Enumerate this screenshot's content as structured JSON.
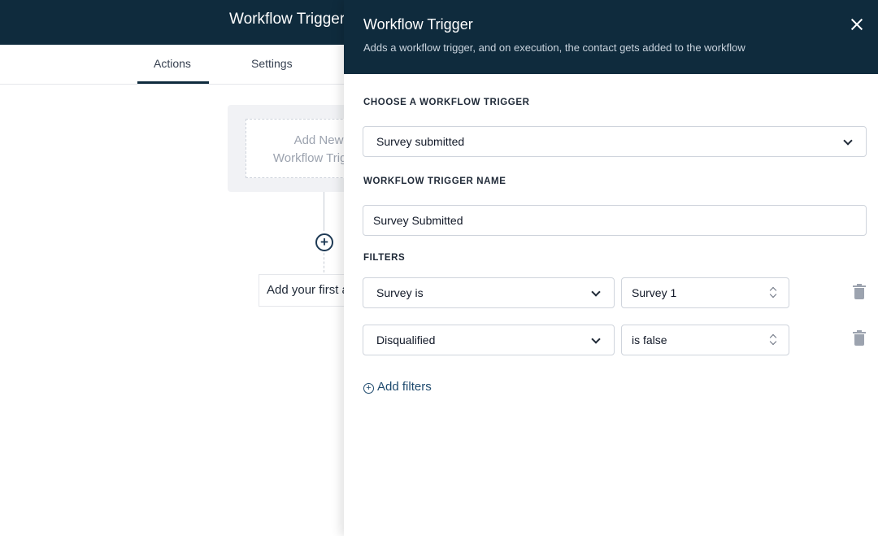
{
  "app": {
    "title": "Workflow Trigger",
    "tabs": [
      {
        "label": "Actions",
        "active": true
      },
      {
        "label": "Settings",
        "active": false
      }
    ],
    "canvas": {
      "trigger_card_text": "Add New Workflow Trigger",
      "add_action_text": "Add your first action"
    }
  },
  "drawer": {
    "title": "Workflow Trigger",
    "subtitle": "Adds a workflow trigger, and on execution, the contact gets added to the workflow",
    "choose_label": "CHOOSE A WORKFLOW TRIGGER",
    "trigger_value": "Survey submitted",
    "name_label": "WORKFLOW TRIGGER NAME",
    "name_value": "Survey Submitted",
    "filters_label": "FILTERS",
    "filters": [
      {
        "field": "Survey is",
        "value": "Survey 1"
      },
      {
        "field": "Disqualified",
        "value": "is false"
      }
    ],
    "add_filters_label": "Add filters"
  },
  "colors": {
    "header_bg": "#0f2b3d",
    "link": "#1e4a6e"
  }
}
